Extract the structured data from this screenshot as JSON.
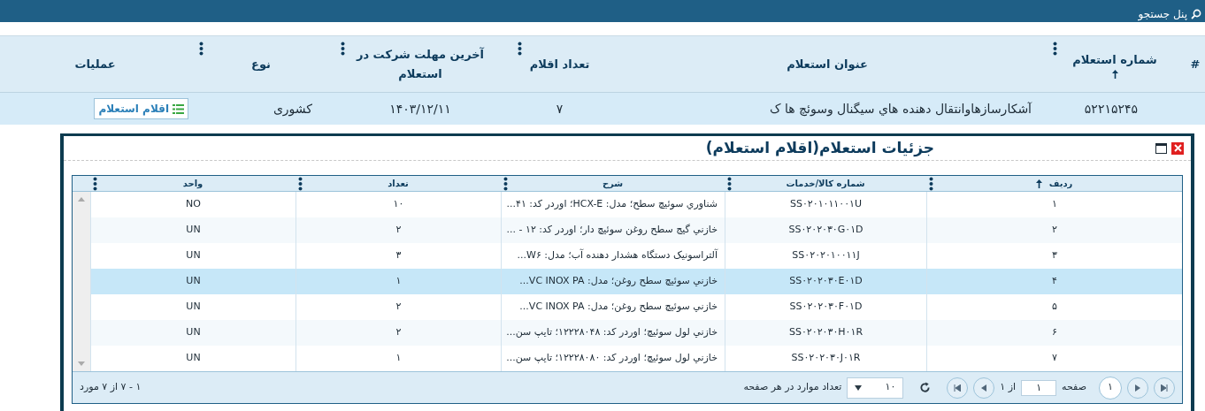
{
  "top_bar": {
    "title": "پنل جستجو"
  },
  "table": {
    "columns": [
      {
        "label": "#",
        "menu": false,
        "sorted": false
      },
      {
        "label": "شماره استعلام",
        "menu": true,
        "sorted": true
      },
      {
        "label": "عنوان استعلام",
        "menu": false,
        "sorted": false
      },
      {
        "label": "تعداد اقلام",
        "menu": true,
        "sorted": false
      },
      {
        "label": "آخرین مهلت شرکت در استعلام",
        "menu": true,
        "sorted": false
      },
      {
        "label": "نوع",
        "menu": true,
        "sorted": false
      },
      {
        "label": "عملیات",
        "menu": false,
        "sorted": false
      }
    ],
    "rows": [
      {
        "selected": true,
        "cells": [
          "",
          "۵۲۲۱۵۲۴۵",
          "آشکارسازهاوانتقال دهنده هاي سيگنال وسوئچ ها ک",
          "۷",
          "۱۴۰۳/۱۲/۱۱",
          "کشوری"
        ],
        "action": "اقلام استعلام"
      }
    ]
  },
  "dialog": {
    "title": "جزئیات استعلام(اقلام استعلام)",
    "grid": {
      "columns": [
        {
          "label": "ردیف",
          "sorted": true
        },
        {
          "label": "شماره کالا/خدمات",
          "sorted": false
        },
        {
          "label": "شرح",
          "sorted": false
        },
        {
          "label": "تعداد",
          "sorted": false
        },
        {
          "label": "واحد",
          "sorted": false
        }
      ],
      "rows": [
        {
          "selected": false,
          "cells": [
            "۱",
            "SS۰۲۰۱۰۱۱۰۰۱U",
            "شناوري سوئيچ سطح؛ مدل: HCX-E؛ اوردر کد: ۴۱...",
            "۱۰",
            "NO"
          ]
        },
        {
          "selected": false,
          "cells": [
            "۲",
            "SS۰۲۰۲۰۳۰G۰۱D",
            "خازني گيج سطح روغن سوئيچ دار؛ اوردر کد: ۱۲ - ...",
            "۲",
            "UN"
          ]
        },
        {
          "selected": false,
          "cells": [
            "۳",
            "SS۰۲۰۲۰۱۰۰۱۱J",
            "آلتراسونیک دستگاه هشدار دهنده آب؛ مدل: W۶...",
            "۳",
            "UN"
          ]
        },
        {
          "selected": true,
          "cells": [
            "۴",
            "SS۰۲۰۲۰۳۰E۰۱D",
            "خازني سوئيچ سطح روغن؛ مدل: VC INOX PA...",
            "۱",
            "UN"
          ]
        },
        {
          "selected": false,
          "cells": [
            "۵",
            "SS۰۲۰۲۰۳۰F۰۱D",
            "خازني سوئيچ سطح روغن؛ مدل: VC INOX PA...",
            "۲",
            "UN"
          ]
        },
        {
          "selected": false,
          "cells": [
            "۶",
            "SS۰۲۰۲۰۳۰H۰۱R",
            "خازني لول سوئيچ؛ اوردر کد: ۱۲۲۲۸۰۴۸؛ تايپ سن...",
            "۲",
            "UN"
          ]
        },
        {
          "selected": false,
          "cells": [
            "۷",
            "SS۰۲۰۲۰۳۰J۰۱R",
            "خازني لول سوئيچ؛ اوردر کد: ۱۲۲۲۸۰۸۰؛ تايپ سن...",
            "۱",
            "UN"
          ]
        }
      ]
    },
    "pager": {
      "current_page": "۱",
      "page_label": "صفحه",
      "page_value": "۱",
      "of_label": "از ۱",
      "page_size": "۱۰",
      "page_size_label": "تعداد موارد در هر صفحه",
      "summary": "۱ - ۷ از ۷ مورد"
    }
  }
}
